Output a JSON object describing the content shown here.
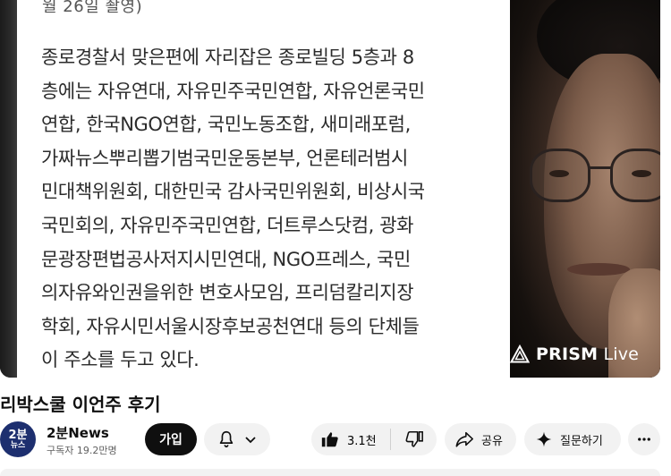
{
  "video": {
    "article_caption": "월 26일 촬영)",
    "article_lines": [
      "종로경찰서 맞은편에 자리잡은 종로빌딩 5층과 8",
      "층에는 자유연대, 자유민주국민연합, 자유언론국민",
      "연합, 한국NGO연합, 국민노동조합, 새미래포럼,",
      "가짜뉴스뿌리뽑기범국민운동본부, 언론테러범시",
      "민대책위원회, 대한민국 감사국민위원회, 비상시국",
      "국민회의, 자유민주국민연합, 더트루스닷컴, 광화",
      "문광장편법공사저지시민연대, NGO프레스, 국민",
      "의자유와인권을위한 변호사모임, 프리덤칼리지장",
      "학회, 자유시민서울시장후보공천연대 등의 단체들",
      "이 주소를 두고 있다."
    ],
    "watermark": {
      "brand": "PRISM",
      "suffix": "Live"
    }
  },
  "title": "리박스쿨 이언주 후기",
  "channel": {
    "avatar_line1": "2분",
    "avatar_line2": "뉴스",
    "name": "2분News",
    "subscribers": "구독자 19.2만명",
    "join_label": "가입"
  },
  "actions": {
    "like_count": "3.1천",
    "share_label": "공유",
    "ask_label": "질문하기"
  },
  "icons": {
    "bell": "bell-icon",
    "chevron": "chevron-down-icon",
    "like": "thumbs-up-icon",
    "dislike": "thumbs-down-icon",
    "share": "share-icon",
    "ask": "sparkle-icon",
    "more": "more-horizontal-icon"
  },
  "colors": {
    "join_button": "#0f0f0f",
    "pill_background": "#f2f2f2",
    "avatar_background": "#1d2f6f"
  }
}
